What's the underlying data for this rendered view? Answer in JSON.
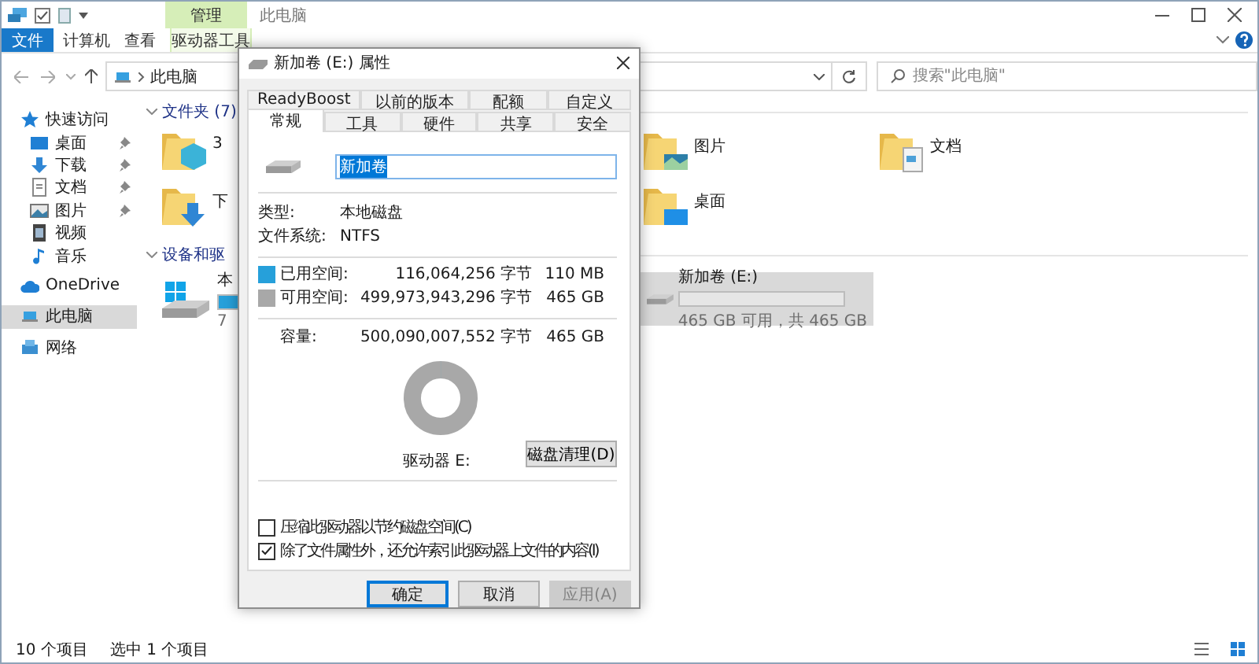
{
  "window": {
    "title": "此电脑",
    "context_tab": "管理"
  },
  "ribbon_tabs": [
    {
      "label": "文件",
      "kind": "file",
      "selected": false
    },
    {
      "label": "计算机",
      "kind": "tab",
      "selected": false
    },
    {
      "label": "查看",
      "kind": "tab",
      "selected": false
    },
    {
      "label": "驱动器工具",
      "kind": "tab",
      "selected": true
    }
  ],
  "address": {
    "path": "此电脑"
  },
  "search": {
    "placeholder": "搜索\"此电脑\""
  },
  "nav": {
    "items": [
      {
        "label": "快速访问",
        "kind": "star",
        "selected": false,
        "children": [
          {
            "label": "桌面",
            "kind": "desktop",
            "selected": false,
            "pinned": true
          },
          {
            "label": "下载",
            "kind": "download",
            "selected": false,
            "pinned": true
          },
          {
            "label": "文档",
            "kind": "document",
            "selected": false,
            "pinned": true
          },
          {
            "label": "图片",
            "kind": "picture",
            "selected": false,
            "pinned": true
          },
          {
            "label": "视频",
            "kind": "video",
            "selected": false,
            "pinned": false
          },
          {
            "label": "音乐",
            "kind": "music",
            "selected": false,
            "pinned": false
          }
        ]
      },
      {
        "label": "OneDrive",
        "kind": "cloud",
        "selected": false
      },
      {
        "label": "此电脑",
        "kind": "pc",
        "selected": true
      },
      {
        "label": "网络",
        "kind": "network",
        "selected": false
      }
    ]
  },
  "folders": {
    "header": "文件夹 (7)",
    "items": [
      {
        "label": "3",
        "kind": "cube"
      },
      {
        "label": "图片",
        "kind": "picture"
      },
      {
        "label": "文档",
        "kind": "document"
      },
      {
        "label": "下",
        "kind": "download"
      },
      {
        "label": "桌面",
        "kind": "desktop"
      }
    ]
  },
  "drives": {
    "header": "设备和驱",
    "items": [
      {
        "label": "本",
        "kind": "system",
        "level": 0.2,
        "detail": "7",
        "selected": false
      },
      {
        "label": "新加卷 (E:)",
        "kind": "disk",
        "level": 0,
        "detail": "465 GB 可用，共 465 GB",
        "selected": true
      }
    ]
  },
  "status_bar": {
    "count": "10 个项目",
    "selection": "选中 1 个项目"
  },
  "dialog": {
    "title": "新加卷 (E:) 属性",
    "tabs_back": [
      {
        "label": "ReadyBoost",
        "selected": false
      },
      {
        "label": "以前的版本",
        "selected": false
      },
      {
        "label": "配额",
        "selected": false
      },
      {
        "label": "自定义",
        "selected": false
      }
    ],
    "tabs_front": [
      {
        "label": "常规",
        "selected": true
      },
      {
        "label": "工具",
        "selected": false
      },
      {
        "label": "硬件",
        "selected": false
      },
      {
        "label": "共享",
        "selected": false
      },
      {
        "label": "安全",
        "selected": false
      }
    ],
    "name": "新加卷",
    "info": [
      {
        "label": "类型:",
        "value": "本地磁盘"
      },
      {
        "label": "文件系统:",
        "value": "NTFS"
      }
    ],
    "space": [
      {
        "label": "已用空间:",
        "bytes": "116,064,256 字节",
        "size": "110 MB",
        "color": "#26a0da"
      },
      {
        "label": "可用空间:",
        "bytes": "499,973,943,296 字节",
        "size": "465 GB",
        "color": "#a8a8a8"
      }
    ],
    "capacity": {
      "label": "容量:",
      "bytes": "500,090,007,552 字节",
      "size": "465 GB"
    },
    "chart": {
      "level": 0.0002
    },
    "drive_label": "驱动器 E:",
    "cleanup_button": "磁盘清理(D)",
    "options": [
      {
        "label": "压缩此驱动器以节约磁盘空间(C)",
        "checked": false
      },
      {
        "label": "除了文件属性外，还允许索引此驱动器上文件的内容(I)",
        "checked": true
      }
    ],
    "buttons": [
      {
        "label": "确定",
        "kind": "default",
        "disabled": false
      },
      {
        "label": "取消",
        "kind": "normal",
        "disabled": false
      },
      {
        "label": "应用(A)",
        "kind": "normal",
        "disabled": true
      }
    ]
  }
}
